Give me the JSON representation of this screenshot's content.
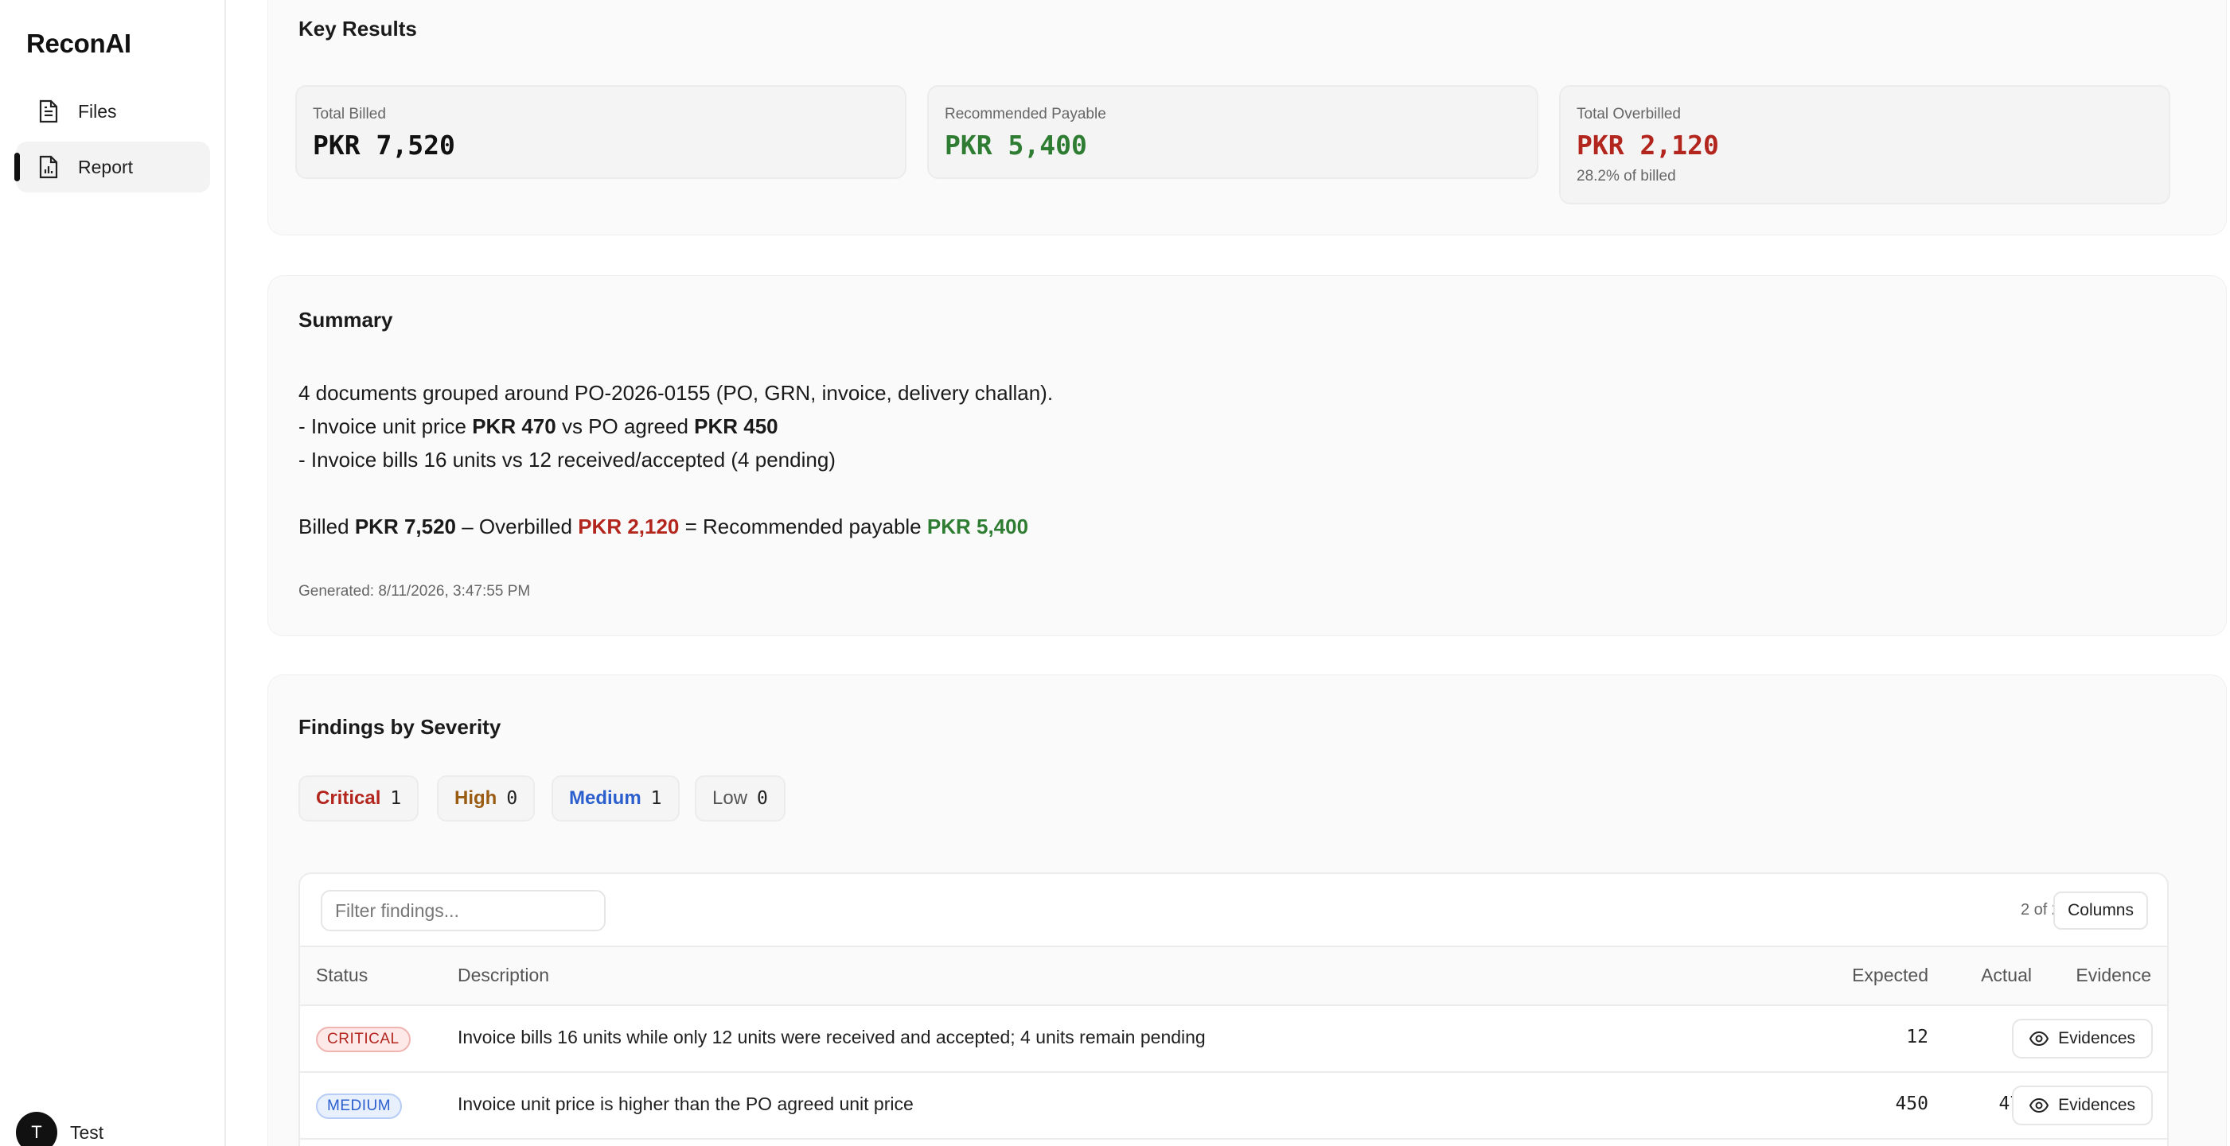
{
  "app": {
    "brand": "ReconAI"
  },
  "sidebar": {
    "items": [
      {
        "label": "Files",
        "icon": "file-icon"
      },
      {
        "label": "Report",
        "icon": "report-icon",
        "active": true
      }
    ],
    "user": {
      "initial": "T",
      "name": "Test"
    }
  },
  "key_results": {
    "title": "Key Results",
    "total_billed": {
      "label": "Total Billed",
      "value": "PKR 7,520"
    },
    "recommended_payable": {
      "label": "Recommended Payable",
      "value": "PKR 5,400"
    },
    "total_overbilled": {
      "label": "Total Overbilled",
      "value": "PKR 2,120",
      "sub": "28.2% of billed"
    }
  },
  "summary": {
    "title": "Summary",
    "line1": "4 documents grouped around PO-2026-0155 (PO, GRN, invoice, delivery challan).",
    "line2": {
      "a": "- Invoice unit price ",
      "b": "PKR 470",
      "c": " vs PO agreed ",
      "d": "PKR 450"
    },
    "line3": "- Invoice bills 16 units vs 12 received/accepted (4 pending)",
    "line4": {
      "a": "Billed ",
      "b": "PKR 7,520",
      "c": " – Overbilled ",
      "d": "PKR 2,120",
      "e": " = Recommended payable ",
      "f": "PKR 5,400"
    },
    "generated": "Generated: 8/11/2026, 3:47:55 PM"
  },
  "findings": {
    "title": "Findings by Severity",
    "severity": [
      {
        "label": "Critical",
        "count": "1"
      },
      {
        "label": "High",
        "count": "0"
      },
      {
        "label": "Medium",
        "count": "1"
      },
      {
        "label": "Low",
        "count": "0"
      }
    ],
    "filter_placeholder": "Filter findings...",
    "count_label": "2 of 2",
    "columns_label": "Columns",
    "headers": {
      "status": "Status",
      "description": "Description",
      "expected": "Expected",
      "actual": "Actual",
      "evidence": "Evidence"
    },
    "rows": [
      {
        "status": "CRITICAL",
        "description": "Invoice bills 16 units while only 12 units were received and accepted; 4 units remain pending",
        "expected": "12",
        "actual": "16",
        "evidence": "Evidences"
      },
      {
        "status": "MEDIUM",
        "description": "Invoice unit price is higher than the PO agreed unit price",
        "expected": "450",
        "actual": "470",
        "evidence": "Evidences"
      }
    ]
  },
  "colors": {
    "critical": "#b3261e",
    "payable": "#2e7d32",
    "medium": "#2b5fce",
    "high": "#9a5b12"
  }
}
